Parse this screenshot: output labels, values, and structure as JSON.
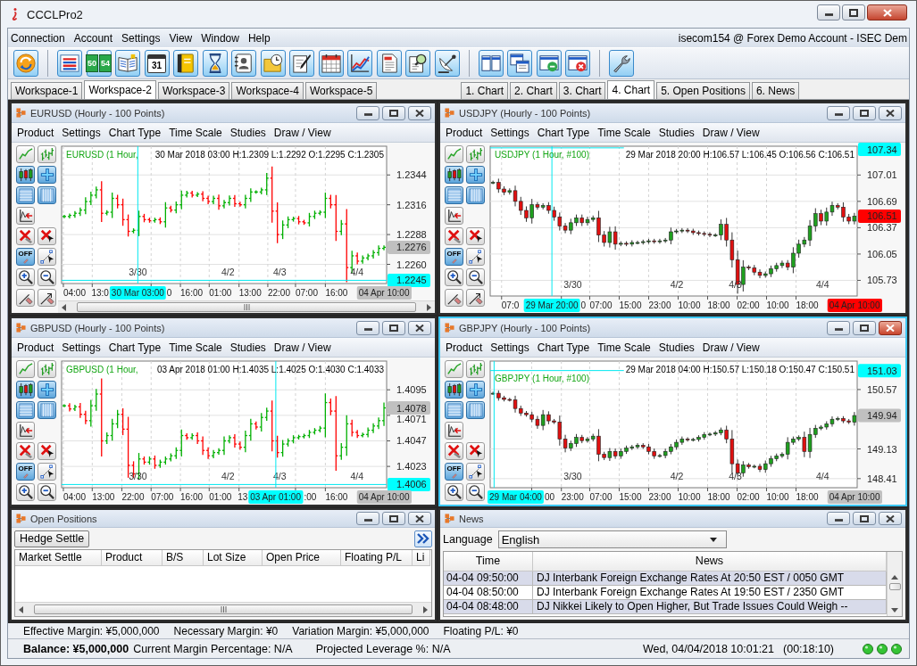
{
  "window": {
    "title": "CCCLPro2"
  },
  "menu": [
    "Connection",
    "Account",
    "Settings",
    "View",
    "Window",
    "Help"
  ],
  "account": "isecom154 @ Forex Demo Account - ISEC Dem",
  "toolbar_labels": {
    "rates": [
      "50",
      "54"
    ],
    "calendar": "31"
  },
  "workspace_tabs": [
    {
      "label": "Workspace-1",
      "selected": false
    },
    {
      "label": "Workspace-2",
      "selected": true
    },
    {
      "label": "Workspace-3",
      "selected": false
    },
    {
      "label": "Workspace-4",
      "selected": false
    },
    {
      "label": "Workspace-5",
      "selected": false
    }
  ],
  "view_tabs": [
    {
      "label": "1. Chart",
      "selected": false
    },
    {
      "label": "2. Chart",
      "selected": false
    },
    {
      "label": "3. Chart",
      "selected": false
    },
    {
      "label": "4. Chart",
      "selected": true
    },
    {
      "label": "5. Open Positions",
      "selected": false
    },
    {
      "label": "6. News",
      "selected": false
    }
  ],
  "chart_panels": [
    {
      "title": "EURUSD (Hourly - 100 Points)",
      "active": false,
      "menu": [
        "Product",
        "Settings",
        "Chart Type",
        "Time Scale",
        "Studies",
        "Draw / View"
      ],
      "tools": [
        {
          "selected": false
        },
        {
          "selected": false
        },
        {
          "selected": true
        },
        {
          "selected": true
        },
        {
          "selected": true
        },
        {
          "selected": true
        },
        {
          "selected": false
        },
        {
          "selected": false
        },
        {
          "selected": false
        },
        {
          "selected": true,
          "text": "OFF"
        },
        {
          "selected": false
        },
        {
          "selected": false
        },
        {
          "selected": false
        },
        {
          "selected": false
        },
        {
          "selected": false
        }
      ],
      "kind": "ohlc",
      "scrollbar": true,
      "legend": "EURUSD (1 Hour,",
      "info": "30 Mar 2018 03:00 H:1.2309 L:1.2292 O:1.2295 C:1.2305",
      "price_labels": [
        "1.2344",
        "1.2316",
        "1.2288",
        "1.2260"
      ],
      "time_labels": [
        "04:00",
        "13:0",
        "0",
        "16:00",
        "01:00",
        "13:00",
        "22:00",
        "07:00",
        "16:00"
      ],
      "date_labels": [
        "3/30",
        "4/2",
        "4/3",
        "4/4"
      ],
      "crosshair": {
        "time_label": "30 Mar 03:00",
        "price_label": "1.2245"
      },
      "last_price": {
        "text": "1.2276",
        "color": "#c0c0c0"
      },
      "last_time": {
        "text": "04 Apr 10:00",
        "color": "#c0c0c0"
      }
    },
    {
      "title": "USDJPY (Hourly - 100 Points)",
      "active": false,
      "menu": [
        "Product",
        "Settings",
        "Chart Type",
        "Time Scale",
        "Studies",
        "Draw / View"
      ],
      "tools": [
        {
          "selected": false
        },
        {
          "selected": false
        },
        {
          "selected": true
        },
        {
          "selected": true
        },
        {
          "selected": true
        },
        {
          "selected": true
        },
        {
          "selected": false
        },
        {
          "selected": false
        },
        {
          "selected": false
        },
        {
          "selected": true,
          "text": "OFF"
        },
        {
          "selected": false
        },
        {
          "selected": false
        },
        {
          "selected": false
        },
        {
          "selected": false
        },
        {
          "selected": false
        }
      ],
      "kind": "candle",
      "scrollbar": false,
      "legend": "USDJPY (1 Hour, #100)",
      "info": "29 Mar 2018 20:00 H:106.57 L:106.45 O:106.56 C:106.51",
      "price_labels": [
        "107.01",
        "106.69",
        "106.37",
        "106.05",
        "105.73"
      ],
      "time_labels": [
        "07:0",
        "0",
        "07:00",
        "15:00",
        "23:00",
        "10:00",
        "18:00",
        "02:00",
        "10:00",
        "18:00"
      ],
      "date_labels": [
        "3/30",
        "4/2",
        "4/3",
        "4/4"
      ],
      "crosshair": {
        "time_label": "29 Mar 20:00",
        "price_label": "107.34"
      },
      "last_price": {
        "text": "106.51",
        "color": "#ff0000"
      },
      "last_time": {
        "text": "04 Apr 10:00",
        "color": "#ff0000"
      }
    },
    {
      "title": "GBPUSD (Hourly - 100 Points)",
      "active": false,
      "menu": [
        "Product",
        "Settings",
        "Chart Type",
        "Time Scale",
        "Studies",
        "Draw / View"
      ],
      "tools": [
        {
          "selected": false
        },
        {
          "selected": false
        },
        {
          "selected": true
        },
        {
          "selected": true
        },
        {
          "selected": true
        },
        {
          "selected": true
        },
        {
          "selected": false
        },
        {
          "selected": false
        },
        {
          "selected": false
        },
        {
          "selected": true,
          "text": "OFF"
        },
        {
          "selected": false
        },
        {
          "selected": false
        },
        {
          "selected": false
        }
      ],
      "kind": "ohlc",
      "scrollbar": false,
      "legend": "GBPUSD (1 Hour,",
      "info": "03 Apr 2018 01:00 H:1.4035 L:1.4025 O:1.4030 C:1.4033",
      "price_labels": [
        "1.4095",
        "1.4071",
        "1.4047",
        "1.4023"
      ],
      "time_labels": [
        "04:00",
        "13:00",
        "22:00",
        "07:00",
        "16:00",
        "01:00",
        "13",
        ":00",
        "16:00"
      ],
      "date_labels": [
        "3/30",
        "4/2",
        "4/3",
        "4/4"
      ],
      "crosshair": {
        "time_label": "03 Apr 01:00",
        "price_label": "1.4006"
      },
      "last_price": {
        "text": "1.4078",
        "color": "#c0c0c0"
      },
      "last_time": {
        "text": "04 Apr 10:00",
        "color": "#c0c0c0"
      }
    },
    {
      "title": "GBPJPY (Hourly - 100 Points)",
      "active": true,
      "menu": [
        "Product",
        "Settings",
        "Chart Type",
        "Time Scale",
        "Studies",
        "Draw / View"
      ],
      "tools": [
        {
          "selected": false
        },
        {
          "selected": false
        },
        {
          "selected": true
        },
        {
          "selected": true
        },
        {
          "selected": true
        },
        {
          "selected": true
        },
        {
          "selected": false
        },
        {
          "selected": false
        },
        {
          "selected": false
        },
        {
          "selected": true,
          "text": "OFF"
        },
        {
          "selected": false
        },
        {
          "selected": false
        },
        {
          "selected": false
        }
      ],
      "kind": "candle",
      "scrollbar": false,
      "legend": "GBPJPY (1 Hour, #100)",
      "info": "29 Mar 2018 04:00 H:150.57 L:150.18 O:150.47 C:150.51",
      "price_labels": [
        "150.57",
        "149.13",
        "148.41"
      ],
      "time_labels": [
        "00",
        "23:00",
        "07:00",
        "15:00",
        "23:00",
        "10:00",
        "18:00",
        "02:00",
        "10:00",
        "18:00"
      ],
      "date_labels": [
        "3/30",
        "4/2",
        "4/3",
        "4/4"
      ],
      "crosshair": {
        "time_label": "29 Mar 04:00",
        "price_label": "151.03"
      },
      "last_price": {
        "text": "149.94",
        "color": "#c0c0c0"
      },
      "last_time": {
        "text": "04 Apr 10:00",
        "color": "#c0c0c0"
      }
    }
  ],
  "open_positions": {
    "title": "Open Positions",
    "button": "Hedge Settle",
    "columns": [
      "Market Settle",
      "Product",
      "B/S",
      "Lot Size",
      "Open Price",
      "Floating P/L",
      "Li"
    ]
  },
  "news": {
    "title": "News",
    "language_label": "Language",
    "language": "English",
    "columns": [
      "Time",
      "News"
    ],
    "rows": [
      {
        "time": "04-04 09:50:00",
        "headline": "DJ Interbank Foreign Exchange Rates At 20:50 EST / 0050 GMT"
      },
      {
        "time": "04-04 08:50:00",
        "headline": "DJ Interbank Foreign Exchange Rates At 19:50 EST / 2350 GMT"
      },
      {
        "time": "04-04 08:48:00",
        "headline": "DJ Nikkei Likely to Open Higher, But Trade Issues Could Weigh --"
      }
    ]
  },
  "status_bar": {
    "items": [
      "Effective Margin: ¥5,000,000",
      "Necessary Margin: ¥0",
      "Variation Margin: ¥5,000,000",
      "Floating P/L: ¥0"
    ],
    "balance": "Balance: ¥5,000,000",
    "details": [
      "Current Margin Percentage: N/A",
      "Projected Leverage %: N/A"
    ],
    "datetime": "Wed, 04/04/2018 10:01:21",
    "elapsed": "(00:18:10)",
    "lights": [
      {
        "on": true
      },
      {
        "on": true
      },
      {
        "on": true
      }
    ]
  }
}
